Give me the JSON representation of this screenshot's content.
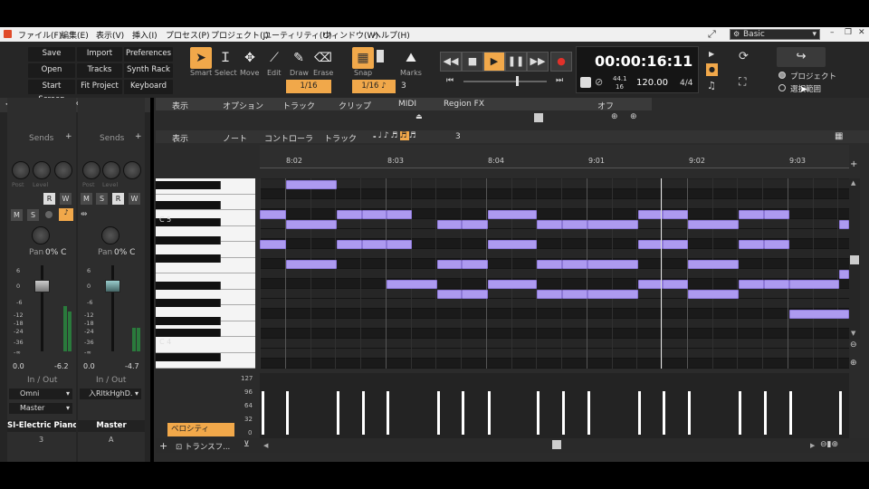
{
  "menu": [
    "ファイル(F)",
    "編集(E)",
    "表示(V)",
    "挿入(I)",
    "プロセス(P)",
    "プロジェクト(J)",
    "ユーティリティ(U)",
    "ウィンドウ(W)",
    "ヘルプ(H)"
  ],
  "workspace": "Basic",
  "quick_buttons": [
    [
      "Save",
      "Import",
      "Preferences"
    ],
    [
      "Open",
      "Tracks",
      "Synth Rack"
    ],
    [
      "Start Screen",
      "Fit Project",
      "Keyboard"
    ]
  ],
  "tools": [
    "Smart",
    "Select",
    "Move",
    "Edit",
    "Draw",
    "Erase"
  ],
  "tool_icons": [
    "arrow-icon",
    "cursor-icon",
    "move-icon",
    "edit-icon",
    "draw-icon",
    "erase-icon"
  ],
  "snap_label": "Snap",
  "marks_label": "Marks",
  "snap_value": "1/16",
  "snap_value2": "1/16",
  "snap_count": "3",
  "time": "00:00:16:11",
  "sample_rate": "44.1",
  "bit_depth": "16",
  "tempo": "120.00",
  "meter": "4/4",
  "scope": {
    "project": "プロジェクト",
    "selection": "選択範囲"
  },
  "pr_menu1": [
    "表示",
    "オプション",
    "トラック",
    "クリップ",
    "MIDI",
    "Region FX"
  ],
  "pr_mode": "オフ",
  "pr_menu2": [
    "表示",
    "ノート",
    "コントローラ",
    "トラック"
  ],
  "pr_divisor": "3",
  "ruler": [
    "8:02",
    "8:03",
    "8:04",
    "9:01",
    "9:02",
    "9:03"
  ],
  "keys": {
    "c5": "C 5",
    "c4": "C 4"
  },
  "velocity_scale": [
    "127",
    "96",
    "64",
    "32",
    "0"
  ],
  "velocity_label": "ベロシティ",
  "transform_label": "トランスフ...",
  "strips": [
    {
      "sends": "Sends",
      "post": "Post",
      "level": "Level",
      "pan_label": "Pan",
      "pan": "0% C",
      "scale": [
        "6",
        "0",
        "-6",
        "-12",
        "-18",
        "-24",
        "-36",
        "-∞"
      ],
      "left_val": "0.0",
      "right_val": "-6.2",
      "io": "In / Out",
      "input": "Omni",
      "output": "Master",
      "name": "SI-Electric Piano",
      "number": "3",
      "buttons": [
        "R",
        "W",
        "M",
        "S"
      ]
    },
    {
      "sends": "Sends",
      "post": "Post",
      "level": "Level",
      "pan_label": "Pan",
      "pan": "0% C",
      "scale": [
        "6",
        "0",
        "-6",
        "-12",
        "-18",
        "-24",
        "-36",
        "-∞"
      ],
      "left_val": "0.0",
      "right_val": "-4.7",
      "io": "In / Out",
      "input": "入RltkHghD.",
      "name": "Master",
      "number": "A",
      "buttons": [
        "M",
        "S",
        "R",
        "W"
      ]
    }
  ],
  "notes": [
    {
      "row": 1,
      "s": 29,
      "e": 85
    },
    {
      "row": 4,
      "s": 0,
      "e": 29
    },
    {
      "row": 4,
      "s": 85,
      "e": 113
    },
    {
      "row": 4,
      "s": 113,
      "e": 140
    },
    {
      "row": 4,
      "s": 140,
      "e": 168
    },
    {
      "row": 4,
      "s": 252,
      "e": 306
    },
    {
      "row": 4,
      "s": 418,
      "e": 445
    },
    {
      "row": 4,
      "s": 445,
      "e": 473
    },
    {
      "row": 4,
      "s": 529,
      "e": 557
    },
    {
      "row": 4,
      "s": 557,
      "e": 585
    },
    {
      "row": 5,
      "s": 29,
      "e": 85
    },
    {
      "row": 5,
      "s": 196,
      "e": 223
    },
    {
      "row": 5,
      "s": 223,
      "e": 252
    },
    {
      "row": 5,
      "s": 306,
      "e": 334
    },
    {
      "row": 5,
      "s": 334,
      "e": 362
    },
    {
      "row": 5,
      "s": 362,
      "e": 418
    },
    {
      "row": 5,
      "s": 473,
      "e": 529
    },
    {
      "row": 5,
      "s": 640,
      "e": 651
    },
    {
      "row": 7,
      "s": 0,
      "e": 29
    },
    {
      "row": 7,
      "s": 85,
      "e": 113
    },
    {
      "row": 7,
      "s": 113,
      "e": 140
    },
    {
      "row": 7,
      "s": 140,
      "e": 168
    },
    {
      "row": 7,
      "s": 252,
      "e": 306
    },
    {
      "row": 7,
      "s": 418,
      "e": 445
    },
    {
      "row": 7,
      "s": 445,
      "e": 473
    },
    {
      "row": 7,
      "s": 529,
      "e": 557
    },
    {
      "row": 7,
      "s": 557,
      "e": 585
    },
    {
      "row": 9,
      "s": 29,
      "e": 85
    },
    {
      "row": 9,
      "s": 196,
      "e": 223
    },
    {
      "row": 9,
      "s": 223,
      "e": 252
    },
    {
      "row": 9,
      "s": 306,
      "e": 334
    },
    {
      "row": 9,
      "s": 334,
      "e": 362
    },
    {
      "row": 9,
      "s": 362,
      "e": 418
    },
    {
      "row": 9,
      "s": 473,
      "e": 529
    },
    {
      "row": 10,
      "s": 640,
      "e": 651
    },
    {
      "row": 11,
      "s": 140,
      "e": 196
    },
    {
      "row": 11,
      "s": 252,
      "e": 306
    },
    {
      "row": 11,
      "s": 418,
      "e": 445
    },
    {
      "row": 11,
      "s": 445,
      "e": 473
    },
    {
      "row": 11,
      "s": 529,
      "e": 557
    },
    {
      "row": 11,
      "s": 557,
      "e": 585
    },
    {
      "row": 11,
      "s": 585,
      "e": 640
    },
    {
      "row": 12,
      "s": 196,
      "e": 223
    },
    {
      "row": 12,
      "s": 223,
      "e": 252
    },
    {
      "row": 12,
      "s": 306,
      "e": 334
    },
    {
      "row": 12,
      "s": 334,
      "e": 362
    },
    {
      "row": 12,
      "s": 362,
      "e": 418
    },
    {
      "row": 12,
      "s": 473,
      "e": 529
    },
    {
      "row": 14,
      "s": 585,
      "e": 651
    }
  ],
  "velocity_ticks": [
    2,
    29,
    85,
    113,
    140,
    196,
    223,
    252,
    306,
    334,
    362,
    418,
    445,
    473,
    529,
    557,
    585,
    640
  ]
}
